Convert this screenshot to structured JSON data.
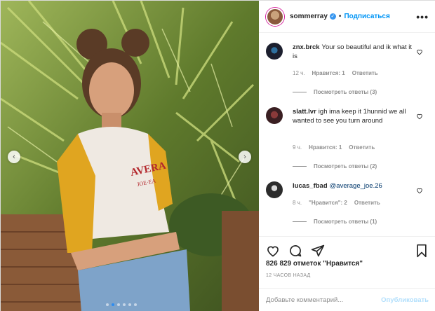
{
  "post": {
    "author": "sommerray",
    "follow_label": "Подписаться",
    "separator": "•",
    "more_label": "•••",
    "shirt_text_line1": "AVERA",
    "shirt_text_line2": "JOE·EA"
  },
  "comments": [
    {
      "user": "znx.brck",
      "text": "Your so beautiful and ik what it is",
      "time": "12 ч.",
      "likes": "Нравится: 1",
      "reply": "Ответить",
      "replies": "Посмотреть ответы (3)",
      "avatar_color": "#1c1f2e"
    },
    {
      "user": "slatt.lvr",
      "text": "igh ima keep it 1hunnid we all wanted to see you turn around",
      "time": "9 ч.",
      "likes": "Нравится: 1",
      "reply": "Ответить",
      "replies": "Посмотреть ответы (2)",
      "avatar_color": "#3a1f22"
    },
    {
      "user": "lucas_fbad",
      "mention": "@average_joe.26",
      "time": "8 ч.",
      "likes": "\"Нравится\": 2",
      "reply": "Ответить",
      "replies": "Посмотреть ответы (1)",
      "avatar_color": "#2b2b2b"
    }
  ],
  "likes_count": "826 829 отметок \"Нравится\"",
  "timestamp": "12 ЧАСОВ НАЗАД",
  "comment_input": {
    "placeholder": "Добавьте комментарий...",
    "value": ""
  },
  "publish_label": "Опубликовать",
  "carousel": {
    "dot_count": 6,
    "active_index": 1
  },
  "colors": {
    "accent": "#0095f6",
    "verified": "#3897f0",
    "muted": "#8e8e8e",
    "publish_disabled": "#b2dffc"
  },
  "icons": [
    "chevron-left-icon",
    "chevron-right-icon",
    "heart-icon",
    "comment-icon",
    "share-icon",
    "bookmark-icon",
    "verified-icon"
  ]
}
